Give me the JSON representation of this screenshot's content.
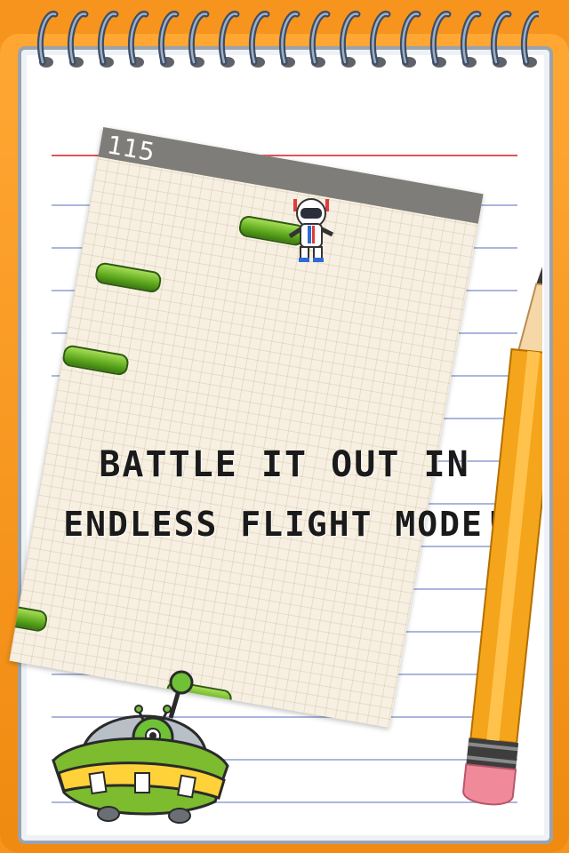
{
  "game": {
    "score": "115",
    "headline_line1": "BATTLE IT OUT IN",
    "headline_line2": "ENDLESS FLIGHT MODE!"
  },
  "colors": {
    "frame_orange": "#f7941d",
    "platform_green": "#5ea91e",
    "score_bar": "#7e7d79",
    "rule_blue": "#aab7dd",
    "rule_red": "#e2535a"
  },
  "icons": [
    "astronaut-icon",
    "ufo-alien-icon",
    "pencil-icon",
    "spiral-binding"
  ]
}
